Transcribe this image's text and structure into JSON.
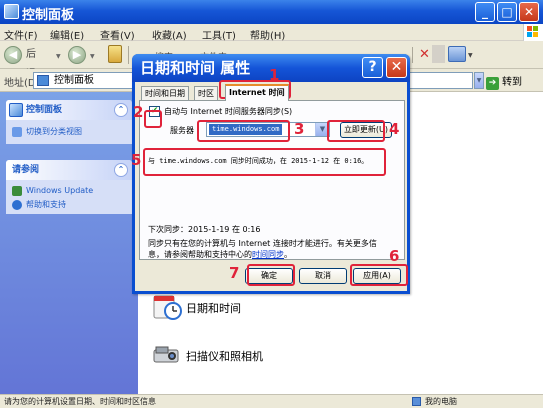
{
  "window": {
    "title": "控制面板"
  },
  "menu": {
    "file": "文件(F)",
    "edit": "编辑(E)",
    "view": "查看(V)",
    "favorites": "收藏(A)",
    "tools": "工具(T)",
    "help": "帮助(H)"
  },
  "toolbar": {
    "back": "后退",
    "search_partial": "搜索",
    "folders_partial": "文件夹"
  },
  "address": {
    "label": "地址(D)",
    "value": "控制面板",
    "go": "转到"
  },
  "taskpane": {
    "control_panel_header": "控制面板",
    "switch_view": "切换到分类视图",
    "see_also_header": "请参阅",
    "windows_update": "Windows Update",
    "help_support": "帮助和支持"
  },
  "content": {
    "datetime": "日期和时间",
    "scanner": "扫描仪和照相机"
  },
  "status": {
    "text": "请为您的计算机设置日期、时间和时区信息",
    "computer": "我的电脑"
  },
  "dialog": {
    "title": "日期和时间 属性",
    "tabs": [
      "时间和日期",
      "时区",
      "Internet 时间"
    ],
    "sync_checkbox": "自动与 Internet 时间服务器同步(S)",
    "server_label": "服务器",
    "server_value": "time.windows.com",
    "update_now": "立即更新(U)",
    "sync_message": "与 time.windows.com 同步时间成功，在 2015-1-12 在 0:16。",
    "next_sync": "下次同步：2015-1-19 在 0:16",
    "note_line1": "同步只有在您的计算机与 Internet 连接时才能进行。有关更多信",
    "note_line2_prefix": "息，请参阅帮助和支持中心的",
    "note_link": "时间同步",
    "note_suffix": "。",
    "ok": "确定",
    "cancel": "取消",
    "apply": "应用(A)"
  },
  "annotations": [
    "1",
    "2",
    "3",
    "4",
    "5",
    "6",
    "7"
  ],
  "colors": {
    "annotation": "#e0233a",
    "titlebar": "#0b45c4",
    "taskpane": "#6375d6"
  }
}
